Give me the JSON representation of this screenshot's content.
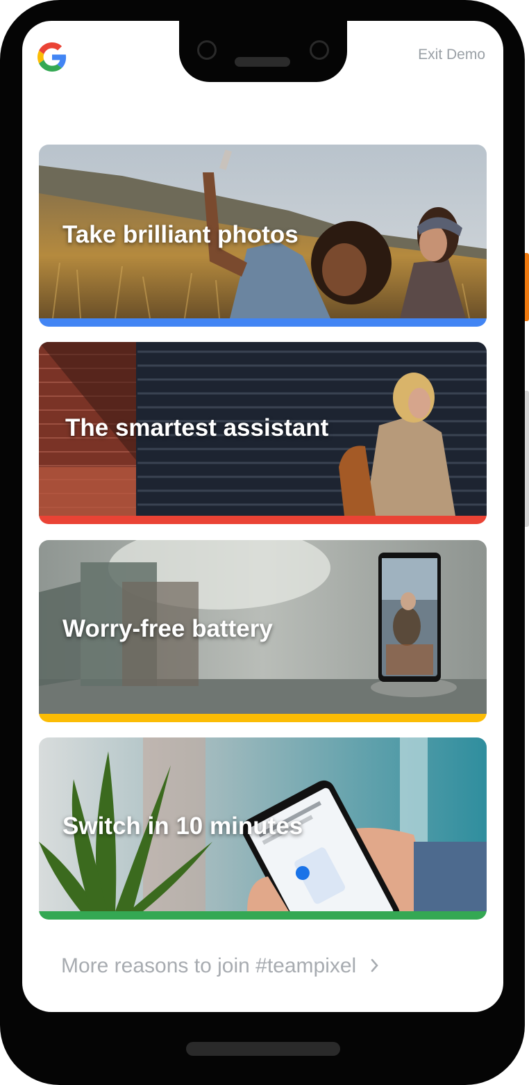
{
  "header": {
    "logo_icon": "google-g-icon",
    "exit_label": "Exit Demo"
  },
  "cards": [
    {
      "title": "Take brilliant photos",
      "accent": "#4285F4"
    },
    {
      "title": "The smartest assistant",
      "accent": "#EA4335"
    },
    {
      "title": "Worry-free battery",
      "accent": "#FBBC05"
    },
    {
      "title": "Switch in 10 minutes",
      "accent": "#34A853"
    }
  ],
  "footer": {
    "more_label": "More reasons to join #teampixel",
    "chevron_icon": "chevron-right-icon"
  },
  "colors": {
    "power_button": "#ef7a10"
  }
}
